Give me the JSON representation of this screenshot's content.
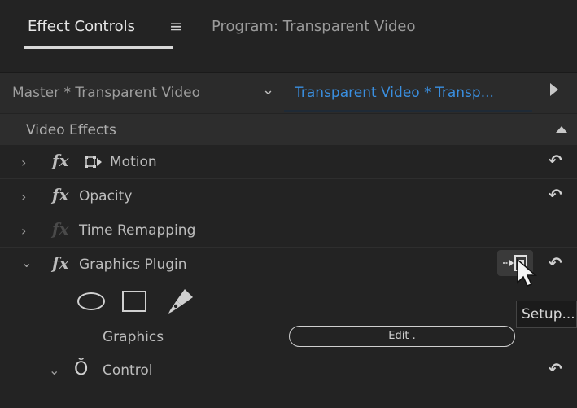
{
  "tabs": {
    "active_label": "Effect Controls",
    "menu_glyph": "≡",
    "program_label": "Program: Transparent Video"
  },
  "clip_header": {
    "master": "Master * Transparent Video",
    "chevron": "⌄",
    "sequence": "Transparent Video * Transp..."
  },
  "video_effects": {
    "label": "Video Effects",
    "items": [
      {
        "name": "Motion",
        "fx": "fx",
        "chevron": "›",
        "reset": "↶"
      },
      {
        "name": "Opacity",
        "fx": "fx",
        "chevron": "›",
        "reset": "↶"
      },
      {
        "name": "Time Remapping",
        "fx": "fx",
        "chevron": "›"
      },
      {
        "name": "Graphics Plugin",
        "fx": "fx",
        "chevron": "⌄",
        "reset": "↶"
      }
    ]
  },
  "graphics": {
    "tools": [
      "ellipse-tool",
      "rectangle-tool",
      "pen-tool"
    ],
    "label": "Graphics",
    "edit_label": "Edit  ."
  },
  "control": {
    "chevron": "⌄",
    "stopwatch": "Ŏ",
    "label": "Control",
    "reset": "↶"
  },
  "tooltip": {
    "text": "Setup..."
  },
  "colors": {
    "background": "#232323",
    "accent_blue": "#3a8fe0",
    "text": "#bdbdbd"
  }
}
